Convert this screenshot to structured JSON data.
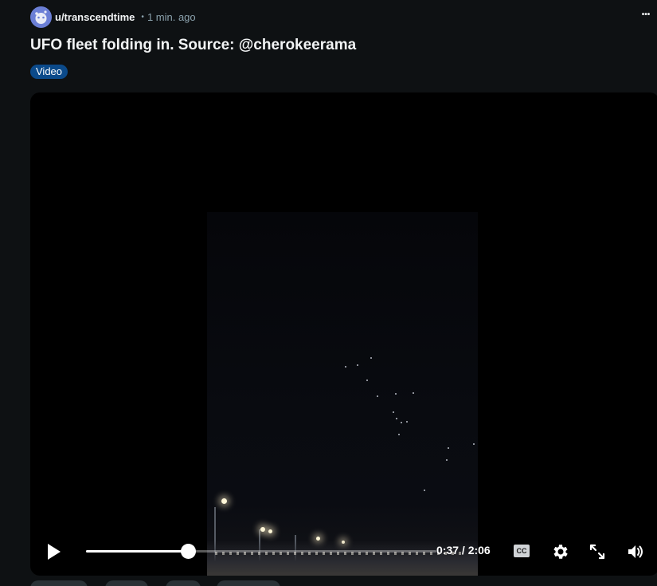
{
  "post": {
    "author": "u/transcendtime",
    "separator": "•",
    "timestamp": "1 min. ago",
    "more_label": "•••",
    "title": "UFO fleet folding in. Source: @cherokeerama",
    "flair": "Video"
  },
  "player": {
    "current_time": "0:37",
    "duration": "2:06",
    "time_display": "0:37 / 2:06",
    "progress_fraction": 0.29,
    "cc_label": "CC"
  },
  "colors": {
    "background": "#0e1113",
    "flair_bg": "#0b4a8a",
    "muted_text": "#8ba2ad"
  },
  "icons": [
    "avatar-icon",
    "more-icon",
    "play-icon",
    "cc-icon",
    "gear-icon",
    "fullscreen-icon",
    "volume-icon"
  ]
}
